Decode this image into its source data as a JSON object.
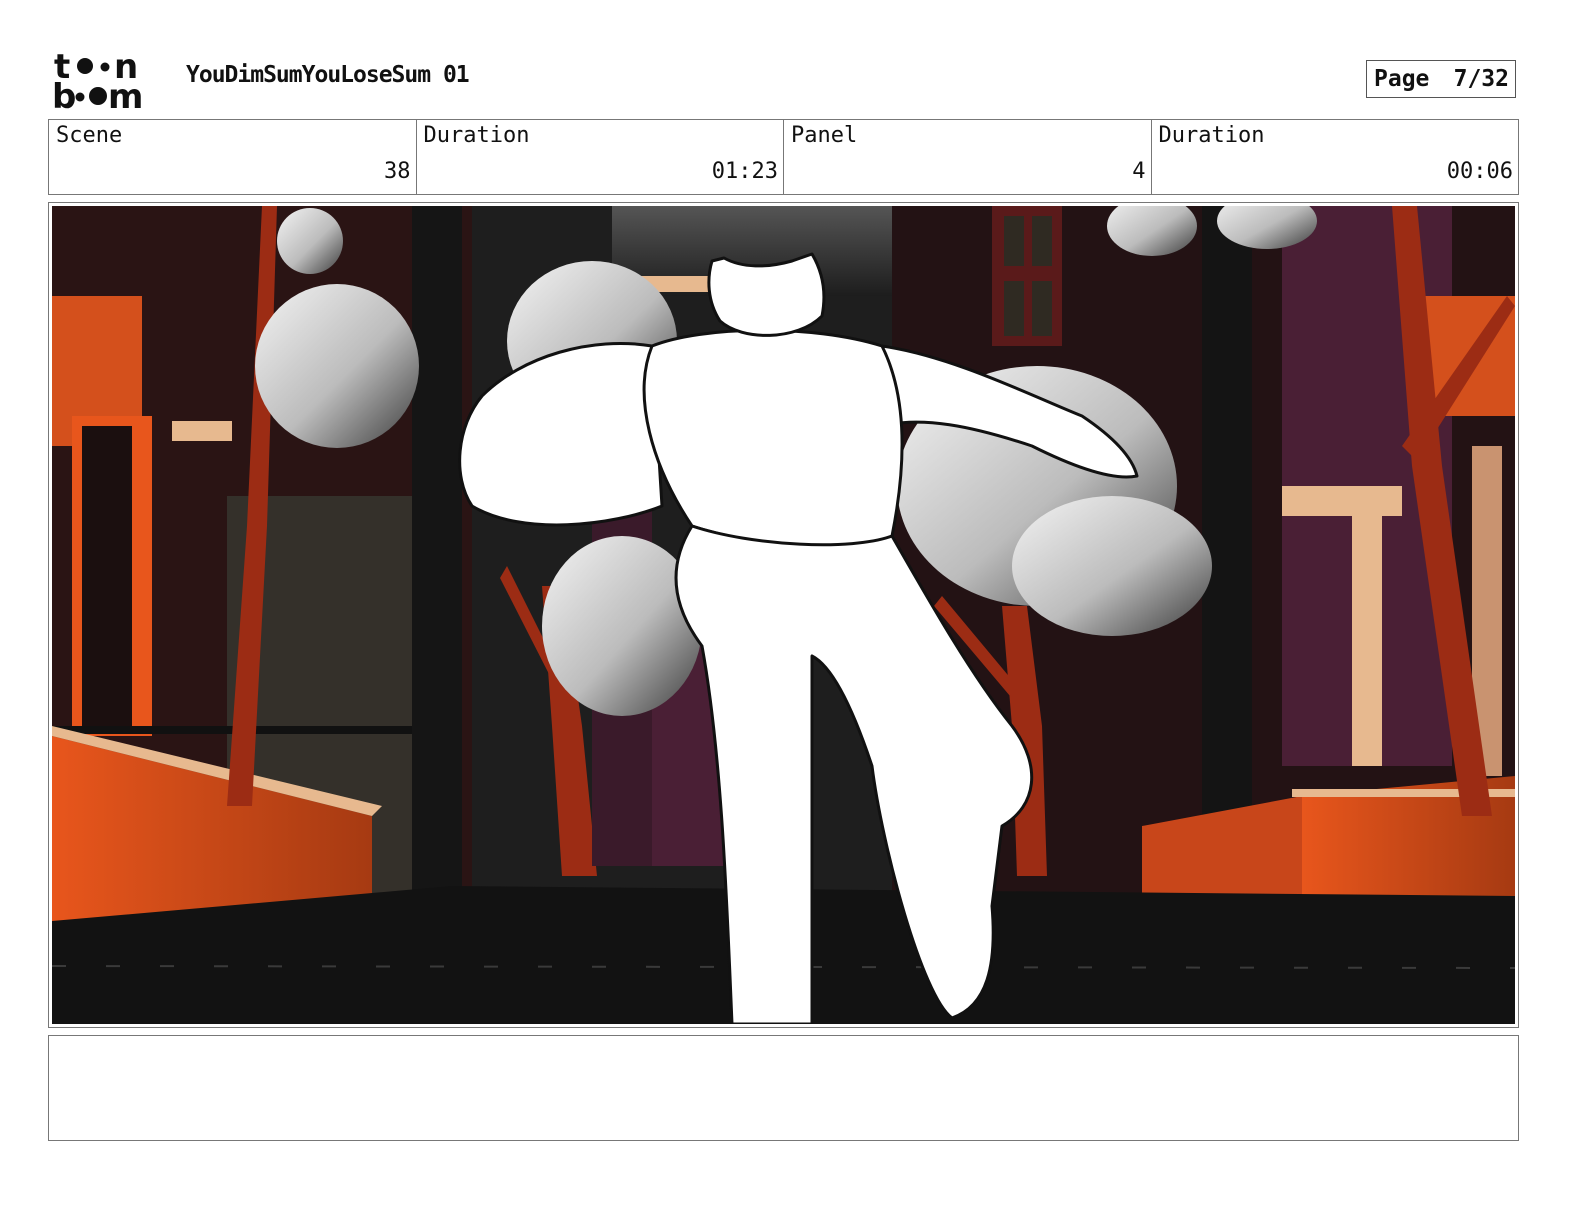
{
  "header": {
    "logo_text_top": "toon",
    "logo_text_bottom": "boom",
    "project_title": "YouDimSumYouLoseSum 01",
    "page_label": "Page",
    "page_value": "7/32"
  },
  "info": {
    "scene_label": "Scene",
    "scene_value": "38",
    "scene_duration_label": "Duration",
    "scene_duration_value": "01:23",
    "panel_label": "Panel",
    "panel_value": "4",
    "panel_duration_label": "Duration",
    "panel_duration_value": "00:06"
  },
  "colors": {
    "brick_orange": "#d4501c",
    "dark_red_trunk": "#9c2c14",
    "purple_wall": "#4a1f35",
    "beige_trim": "#e7b98f",
    "ground": "#121212",
    "sky": "#3a3a3a"
  },
  "notes": {
    "text": ""
  }
}
